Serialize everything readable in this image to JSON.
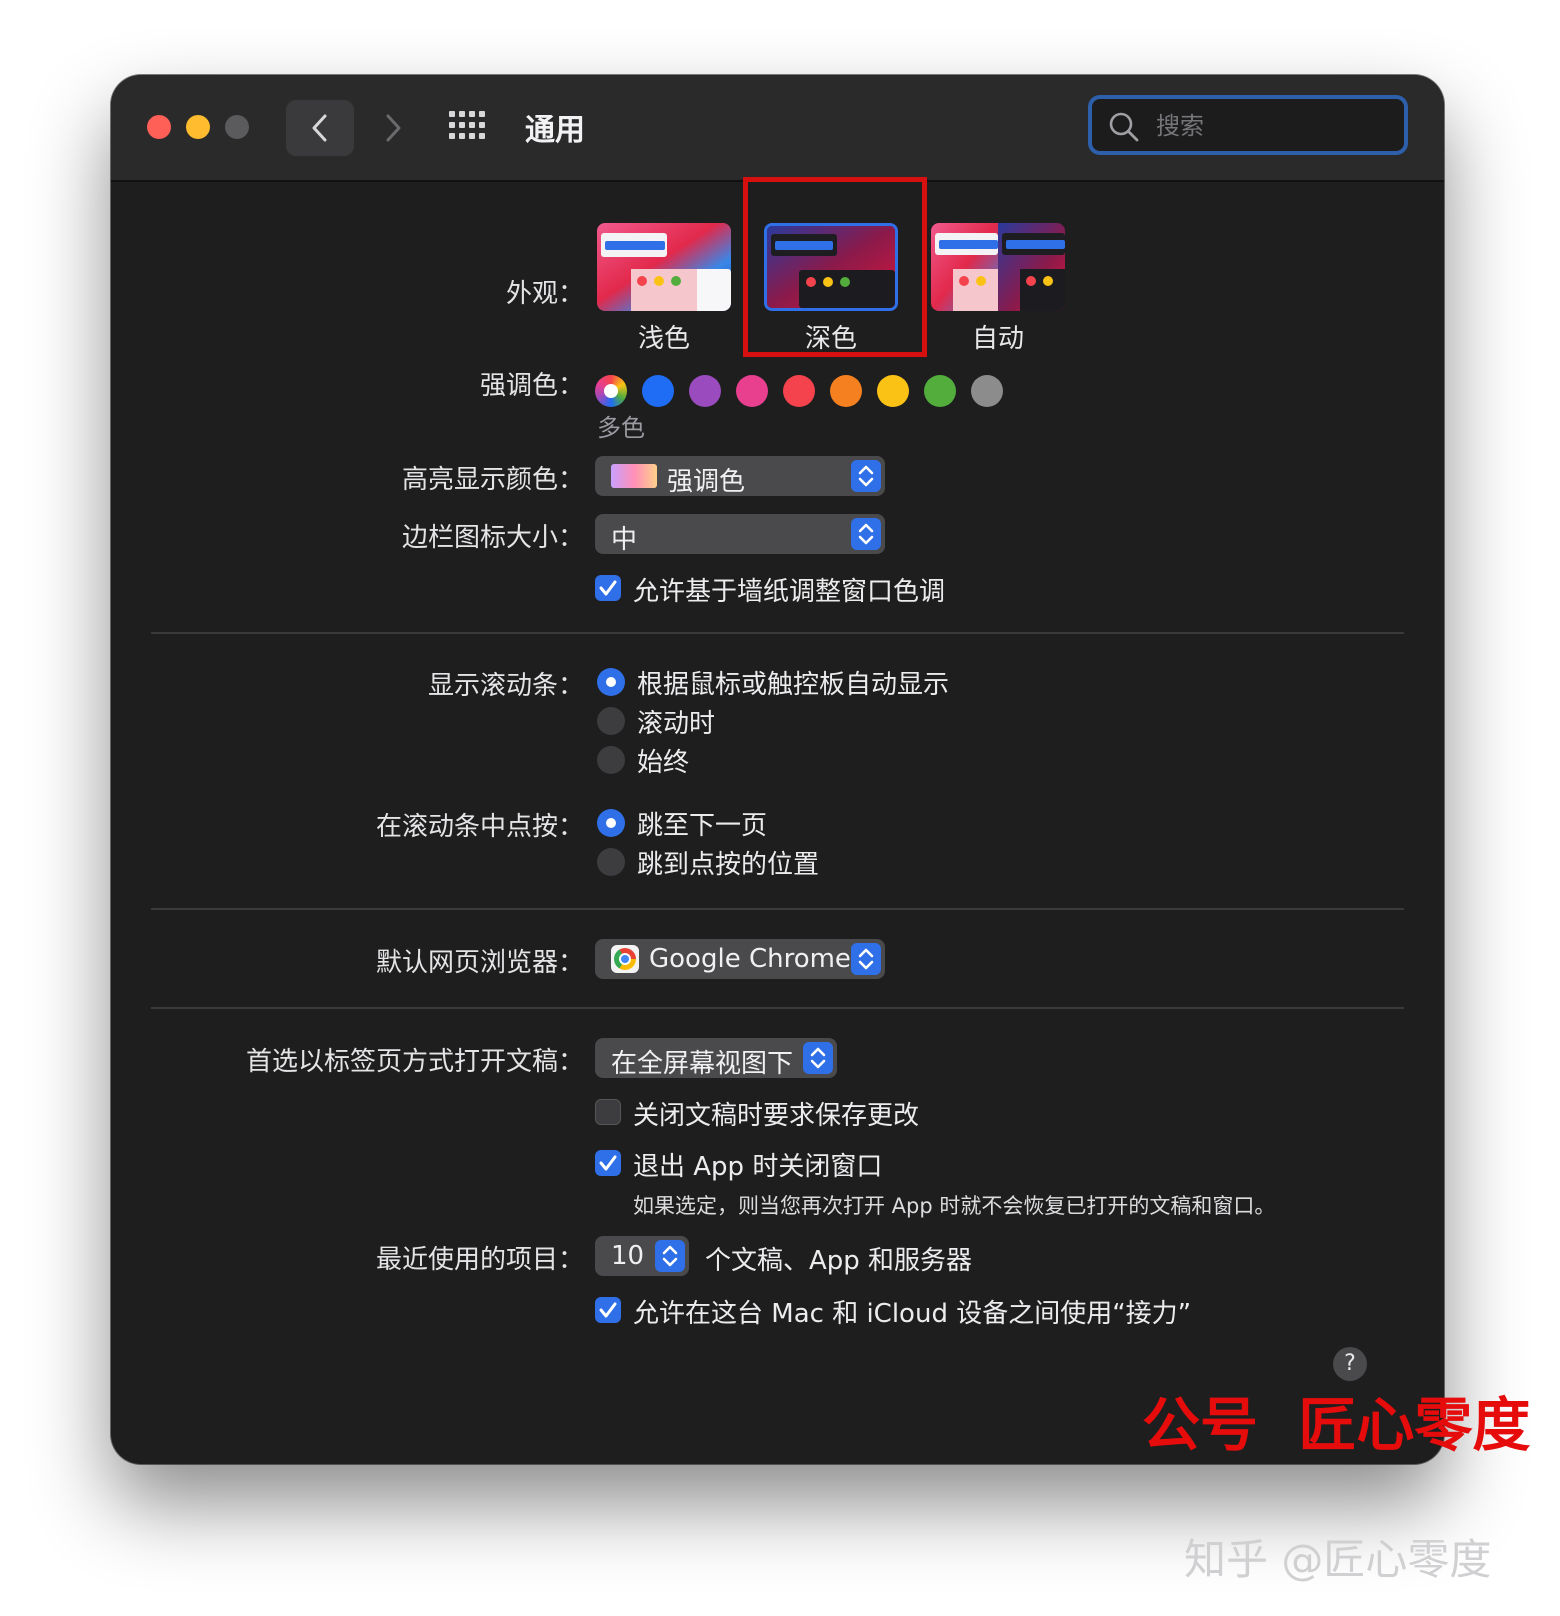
{
  "window": {
    "title": "通用",
    "search_placeholder": "搜索"
  },
  "appearance": {
    "label": "外观：",
    "options": [
      {
        "name": "浅色",
        "selected": false
      },
      {
        "name": "深色",
        "selected": true
      },
      {
        "name": "自动",
        "selected": false
      }
    ]
  },
  "accent": {
    "label": "强调色：",
    "colors": [
      "multicolor",
      "#1f6cf5",
      "#9a4bbd",
      "#e83f8f",
      "#f4434c",
      "#f5801f",
      "#fbc216",
      "#52ad3c",
      "#8c8c8c"
    ],
    "selected_name": "多色"
  },
  "highlight": {
    "label": "高亮显示颜色：",
    "value": "强调色"
  },
  "sidebar_icon_size": {
    "label": "边栏图标大小：",
    "value": "中"
  },
  "wallpaper_tint": {
    "label": "允许基于墙纸调整窗口色调",
    "checked": true
  },
  "show_scrollbars": {
    "label": "显示滚动条：",
    "options": [
      {
        "text": "根据鼠标或触控板自动显示",
        "selected": true
      },
      {
        "text": "滚动时",
        "selected": false
      },
      {
        "text": "始终",
        "selected": false
      }
    ]
  },
  "click_scrollbar": {
    "label": "在滚动条中点按：",
    "options": [
      {
        "text": "跳至下一页",
        "selected": true
      },
      {
        "text": "跳到点按的位置",
        "selected": false
      }
    ]
  },
  "default_browser": {
    "label": "默认网页浏览器：",
    "value": "Google Chrome"
  },
  "prefer_tabs": {
    "label": "首选以标签页方式打开文稿：",
    "value": "在全屏幕视图下"
  },
  "ask_save": {
    "label": "关闭文稿时要求保存更改",
    "checked": false
  },
  "close_windows": {
    "label": "退出 App 时关闭窗口",
    "checked": true,
    "note": "如果选定，则当您再次打开 App 时就不会恢复已打开的文稿和窗口。"
  },
  "recent_items": {
    "label": "最近使用的项目：",
    "value": "10",
    "suffix": "个文稿、App 和服务器"
  },
  "handoff": {
    "label": "允许在这台 Mac 和 iCloud 设备之间使用“接力”",
    "checked": true
  },
  "help_button": "?",
  "watermark_red": "公号  匠心零度",
  "watermark_gray": "知乎 @匠心零度",
  "colors": {
    "window_bg": "#1e1e1f",
    "accent_blue": "#2f6fe8",
    "highlight_red": "#d60f0f"
  }
}
